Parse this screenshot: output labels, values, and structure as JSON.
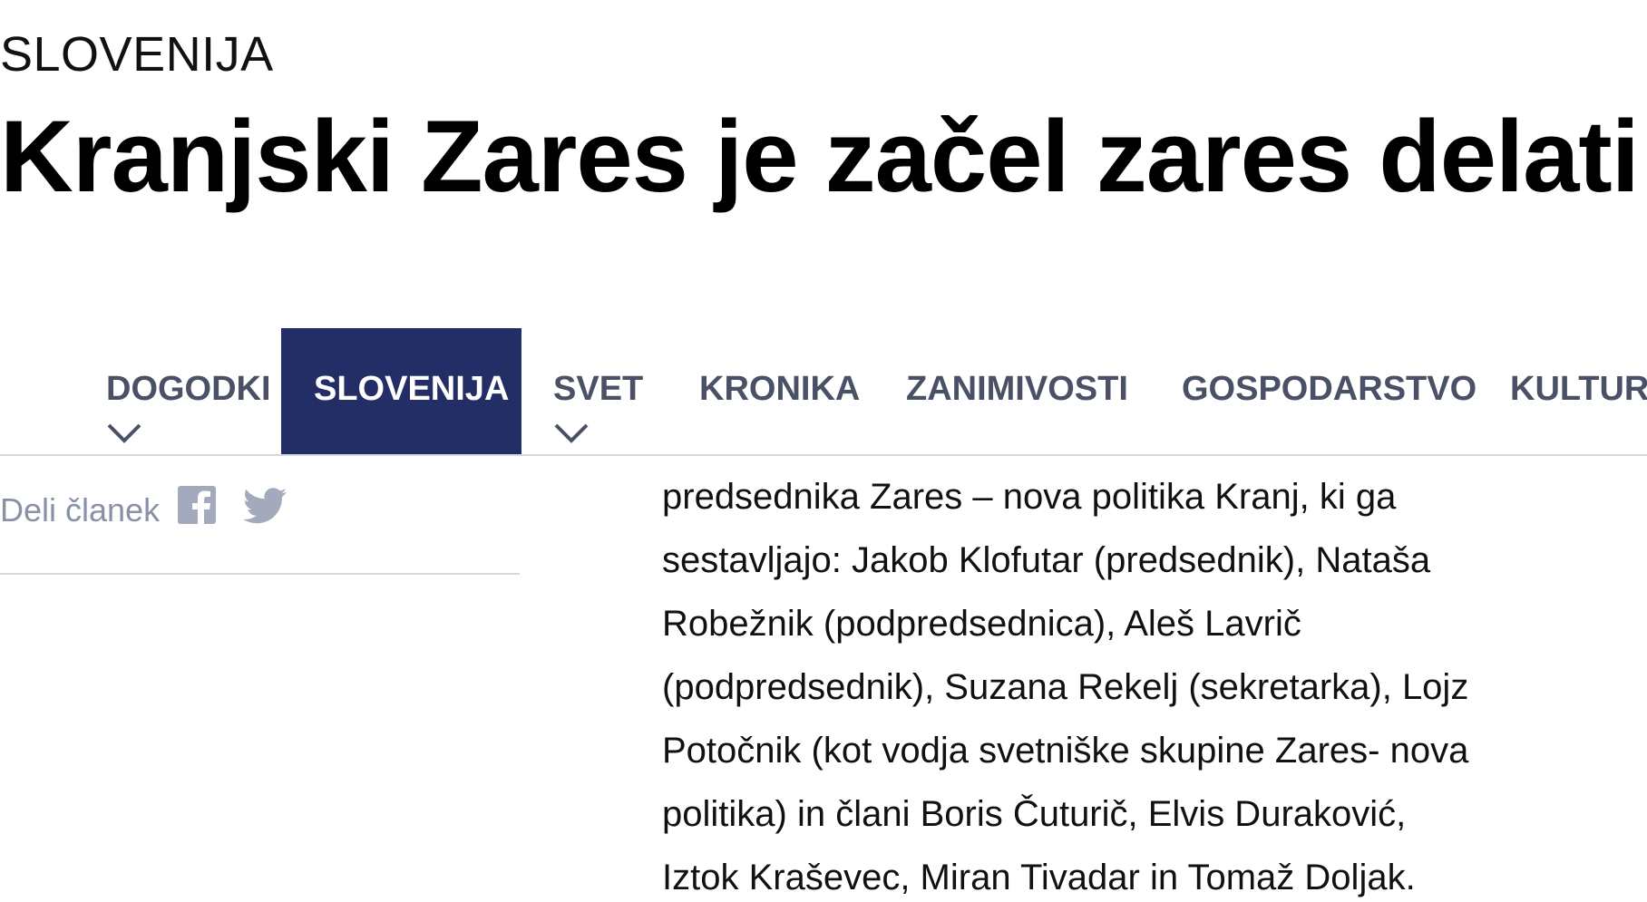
{
  "article": {
    "section": "SLOVENIJA",
    "title": "Kranjski Zares je začel zares delati",
    "body_lines": [
      "predsednika Zares – nova politika Kranj, ki ga",
      "sestavljajo: Jakob Klofutar (predsednik), Nataša",
      "Robežnik (podpredsednica), Aleš Lavrič",
      "(podpredsednik), Suzana Rekelj (sekretarka), Lojz",
      "Potočnik (kot vodja svetniške skupine Zares- nova",
      "politika) in člani Boris Čuturič, Elvis Duraković,",
      "Iztok Kraševec, Miran Tivadar in Tomaž Doljak."
    ]
  },
  "nav": {
    "active": "SLOVENIJA",
    "items": [
      {
        "label": "DOGODKI",
        "has_dropdown": true
      },
      {
        "label": "SLOVENIJA",
        "has_dropdown": false
      },
      {
        "label": "SVET",
        "has_dropdown": true
      },
      {
        "label": "KRONIKA",
        "has_dropdown": false
      },
      {
        "label": "ZANIMIVOSTI",
        "has_dropdown": false
      },
      {
        "label": "GOSPODARSTVO",
        "has_dropdown": false
      },
      {
        "label": "KULTURA",
        "has_dropdown": false
      }
    ]
  },
  "share": {
    "label": "Deli članek",
    "icons": [
      "facebook-icon",
      "twitter-icon"
    ]
  },
  "colors": {
    "nav_active_bg": "#232d66",
    "nav_text": "#4a5166",
    "muted_text": "#8891a6",
    "icon": "#a3aabb",
    "divider": "#d5d8de"
  }
}
